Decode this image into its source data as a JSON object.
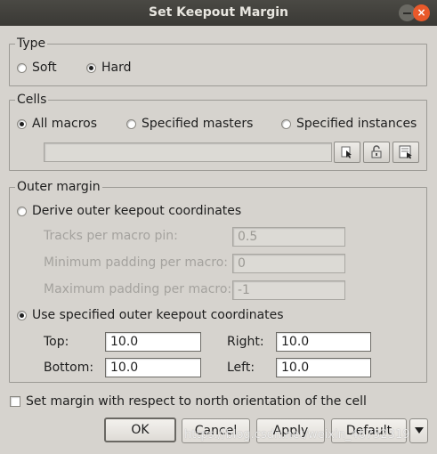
{
  "window": {
    "title": "Set Keepout Margin"
  },
  "type_group": {
    "legend": "Type",
    "options": [
      {
        "label": "Soft",
        "selected": false
      },
      {
        "label": "Hard",
        "selected": true
      }
    ]
  },
  "cells_group": {
    "legend": "Cells",
    "options": [
      {
        "label": "All macros",
        "selected": true
      },
      {
        "label": "Specified masters",
        "selected": false
      },
      {
        "label": "Specified instances",
        "selected": false
      }
    ],
    "selection_value": ""
  },
  "outer_group": {
    "legend": "Outer margin",
    "derive_label": "Derive outer keepout coordinates",
    "tracks_label": "Tracks per macro pin:",
    "tracks_value": "0.5",
    "min_pad_label": "Minimum padding per macro:",
    "min_pad_value": "0",
    "max_pad_label": "Maximum padding per macro:",
    "max_pad_value": "-1",
    "use_label": "Use specified outer keepout coordinates",
    "top_label": "Top:",
    "top_value": "10.0",
    "right_label": "Right:",
    "right_value": "10.0",
    "bottom_label": "Bottom:",
    "bottom_value": "10.0",
    "left_label": "Left:",
    "left_value": "10.0"
  },
  "north_orientation": {
    "label": "Set margin with respect to north orientation of the cell",
    "checked": false
  },
  "buttons": {
    "ok": "OK",
    "cancel": "Cancel",
    "apply": "Apply",
    "default": "Default"
  },
  "watermark": "https://blog.csdn.net/weixin_46752319",
  "icons": [
    "close-icon",
    "minimize-icon",
    "select-cursor-icon",
    "lock-icon",
    "load-list-icon",
    "dropdown-arrow-icon"
  ]
}
